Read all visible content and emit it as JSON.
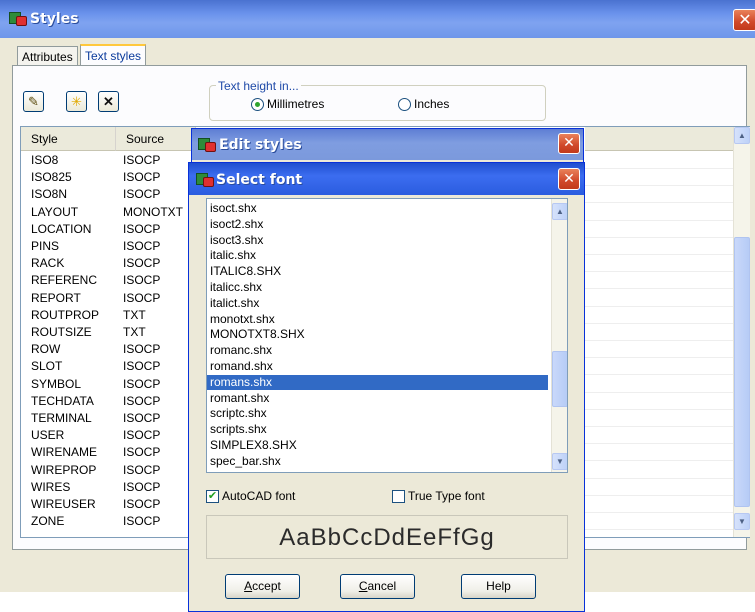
{
  "main_window": {
    "title": "Styles",
    "tabs": [
      {
        "label": "Attributes"
      },
      {
        "label": "Text styles"
      }
    ],
    "toolbar_icons": [
      "pencil-icon",
      "new-style-icon",
      "delete-x-icon"
    ],
    "text_height": {
      "group_label": "Text height in...",
      "options": [
        {
          "label": "Millimetres",
          "selected": true
        },
        {
          "label": "Inches",
          "selected": false
        }
      ]
    },
    "table": {
      "headers": [
        "Style",
        "Source"
      ],
      "rows": [
        {
          "style": "ISO8",
          "source": "ISOCP"
        },
        {
          "style": "ISO825",
          "source": "ISOCP"
        },
        {
          "style": "ISO8N",
          "source": "ISOCP"
        },
        {
          "style": "LAYOUT",
          "source": "MONOTXT"
        },
        {
          "style": "LOCATION",
          "source": "ISOCP"
        },
        {
          "style": "PINS",
          "source": "ISOCP"
        },
        {
          "style": "RACK",
          "source": "ISOCP"
        },
        {
          "style": "REFERENC",
          "source": "ISOCP"
        },
        {
          "style": "REPORT",
          "source": "ISOCP"
        },
        {
          "style": "ROUTPROP",
          "source": "TXT"
        },
        {
          "style": "ROUTSIZE",
          "source": "TXT"
        },
        {
          "style": "ROW",
          "source": "ISOCP"
        },
        {
          "style": "SLOT",
          "source": "ISOCP"
        },
        {
          "style": "SYMBOL",
          "source": "ISOCP"
        },
        {
          "style": "TECHDATA",
          "source": "ISOCP"
        },
        {
          "style": "TERMINAL",
          "source": "ISOCP"
        },
        {
          "style": "USER",
          "source": "ISOCP"
        },
        {
          "style": "WIRENAME",
          "source": "ISOCP"
        },
        {
          "style": "WIREPROP",
          "source": "ISOCP"
        },
        {
          "style": "WIRES",
          "source": "ISOCP"
        },
        {
          "style": "WIREUSER",
          "source": "ISOCP"
        },
        {
          "style": "ZONE",
          "source": "ISOCP"
        }
      ]
    }
  },
  "edit_dialog": {
    "title": "Edit styles"
  },
  "select_font_dialog": {
    "title": "Select font",
    "fonts": [
      "isoct.shx",
      "isoct2.shx",
      "isoct3.shx",
      "italic.shx",
      "ITALIC8.SHX",
      "italicc.shx",
      "italict.shx",
      "monotxt.shx",
      "MONOTXT8.SHX",
      "romanc.shx",
      "romand.shx",
      "romans.shx",
      "romant.shx",
      "scriptc.shx",
      "scripts.shx",
      "SIMPLEX8.SHX",
      "spec_bar.shx"
    ],
    "selected_font": "romans.shx",
    "autocad_font": {
      "label": "AutoCAD font",
      "checked": true
    },
    "truetype_font": {
      "label": "True Type font",
      "checked": false
    },
    "preview_text": "AaBbCcDdEeFfGg",
    "buttons": {
      "accept": {
        "mnemonic": "A",
        "rest": "ccept"
      },
      "cancel": {
        "mnemonic": "C",
        "rest": "ancel"
      },
      "help": {
        "label": "Help"
      }
    }
  },
  "colors": {
    "titlebar_active": "#2a5cdf",
    "selection": "#316ac5",
    "tab_accent": "#ffc83c",
    "close_button": "#d0482a"
  }
}
